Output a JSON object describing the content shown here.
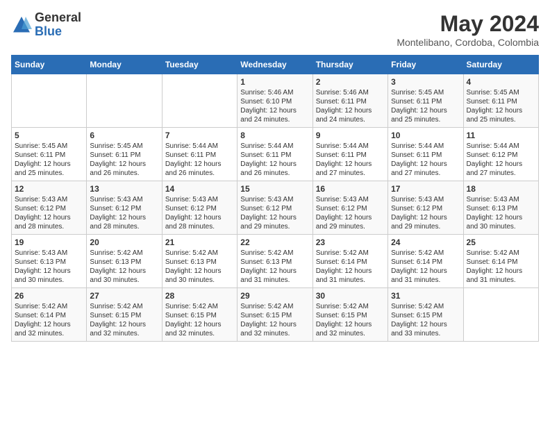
{
  "header": {
    "logo_general": "General",
    "logo_blue": "Blue",
    "month_year": "May 2024",
    "location": "Montelibano, Cordoba, Colombia"
  },
  "days_of_week": [
    "Sunday",
    "Monday",
    "Tuesday",
    "Wednesday",
    "Thursday",
    "Friday",
    "Saturday"
  ],
  "weeks": [
    {
      "days": [
        {
          "number": "",
          "info": ""
        },
        {
          "number": "",
          "info": ""
        },
        {
          "number": "",
          "info": ""
        },
        {
          "number": "1",
          "info": "Sunrise: 5:46 AM\nSunset: 6:10 PM\nDaylight: 12 hours and 24 minutes."
        },
        {
          "number": "2",
          "info": "Sunrise: 5:46 AM\nSunset: 6:11 PM\nDaylight: 12 hours and 24 minutes."
        },
        {
          "number": "3",
          "info": "Sunrise: 5:45 AM\nSunset: 6:11 PM\nDaylight: 12 hours and 25 minutes."
        },
        {
          "number": "4",
          "info": "Sunrise: 5:45 AM\nSunset: 6:11 PM\nDaylight: 12 hours and 25 minutes."
        }
      ]
    },
    {
      "days": [
        {
          "number": "5",
          "info": "Sunrise: 5:45 AM\nSunset: 6:11 PM\nDaylight: 12 hours and 25 minutes."
        },
        {
          "number": "6",
          "info": "Sunrise: 5:45 AM\nSunset: 6:11 PM\nDaylight: 12 hours and 26 minutes."
        },
        {
          "number": "7",
          "info": "Sunrise: 5:44 AM\nSunset: 6:11 PM\nDaylight: 12 hours and 26 minutes."
        },
        {
          "number": "8",
          "info": "Sunrise: 5:44 AM\nSunset: 6:11 PM\nDaylight: 12 hours and 26 minutes."
        },
        {
          "number": "9",
          "info": "Sunrise: 5:44 AM\nSunset: 6:11 PM\nDaylight: 12 hours and 27 minutes."
        },
        {
          "number": "10",
          "info": "Sunrise: 5:44 AM\nSunset: 6:11 PM\nDaylight: 12 hours and 27 minutes."
        },
        {
          "number": "11",
          "info": "Sunrise: 5:44 AM\nSunset: 6:12 PM\nDaylight: 12 hours and 27 minutes."
        }
      ]
    },
    {
      "days": [
        {
          "number": "12",
          "info": "Sunrise: 5:43 AM\nSunset: 6:12 PM\nDaylight: 12 hours and 28 minutes."
        },
        {
          "number": "13",
          "info": "Sunrise: 5:43 AM\nSunset: 6:12 PM\nDaylight: 12 hours and 28 minutes."
        },
        {
          "number": "14",
          "info": "Sunrise: 5:43 AM\nSunset: 6:12 PM\nDaylight: 12 hours and 28 minutes."
        },
        {
          "number": "15",
          "info": "Sunrise: 5:43 AM\nSunset: 6:12 PM\nDaylight: 12 hours and 29 minutes."
        },
        {
          "number": "16",
          "info": "Sunrise: 5:43 AM\nSunset: 6:12 PM\nDaylight: 12 hours and 29 minutes."
        },
        {
          "number": "17",
          "info": "Sunrise: 5:43 AM\nSunset: 6:12 PM\nDaylight: 12 hours and 29 minutes."
        },
        {
          "number": "18",
          "info": "Sunrise: 5:43 AM\nSunset: 6:13 PM\nDaylight: 12 hours and 30 minutes."
        }
      ]
    },
    {
      "days": [
        {
          "number": "19",
          "info": "Sunrise: 5:43 AM\nSunset: 6:13 PM\nDaylight: 12 hours and 30 minutes."
        },
        {
          "number": "20",
          "info": "Sunrise: 5:42 AM\nSunset: 6:13 PM\nDaylight: 12 hours and 30 minutes."
        },
        {
          "number": "21",
          "info": "Sunrise: 5:42 AM\nSunset: 6:13 PM\nDaylight: 12 hours and 30 minutes."
        },
        {
          "number": "22",
          "info": "Sunrise: 5:42 AM\nSunset: 6:13 PM\nDaylight: 12 hours and 31 minutes."
        },
        {
          "number": "23",
          "info": "Sunrise: 5:42 AM\nSunset: 6:14 PM\nDaylight: 12 hours and 31 minutes."
        },
        {
          "number": "24",
          "info": "Sunrise: 5:42 AM\nSunset: 6:14 PM\nDaylight: 12 hours and 31 minutes."
        },
        {
          "number": "25",
          "info": "Sunrise: 5:42 AM\nSunset: 6:14 PM\nDaylight: 12 hours and 31 minutes."
        }
      ]
    },
    {
      "days": [
        {
          "number": "26",
          "info": "Sunrise: 5:42 AM\nSunset: 6:14 PM\nDaylight: 12 hours and 32 minutes."
        },
        {
          "number": "27",
          "info": "Sunrise: 5:42 AM\nSunset: 6:15 PM\nDaylight: 12 hours and 32 minutes."
        },
        {
          "number": "28",
          "info": "Sunrise: 5:42 AM\nSunset: 6:15 PM\nDaylight: 12 hours and 32 minutes."
        },
        {
          "number": "29",
          "info": "Sunrise: 5:42 AM\nSunset: 6:15 PM\nDaylight: 12 hours and 32 minutes."
        },
        {
          "number": "30",
          "info": "Sunrise: 5:42 AM\nSunset: 6:15 PM\nDaylight: 12 hours and 32 minutes."
        },
        {
          "number": "31",
          "info": "Sunrise: 5:42 AM\nSunset: 6:15 PM\nDaylight: 12 hours and 33 minutes."
        },
        {
          "number": "",
          "info": ""
        }
      ]
    }
  ]
}
